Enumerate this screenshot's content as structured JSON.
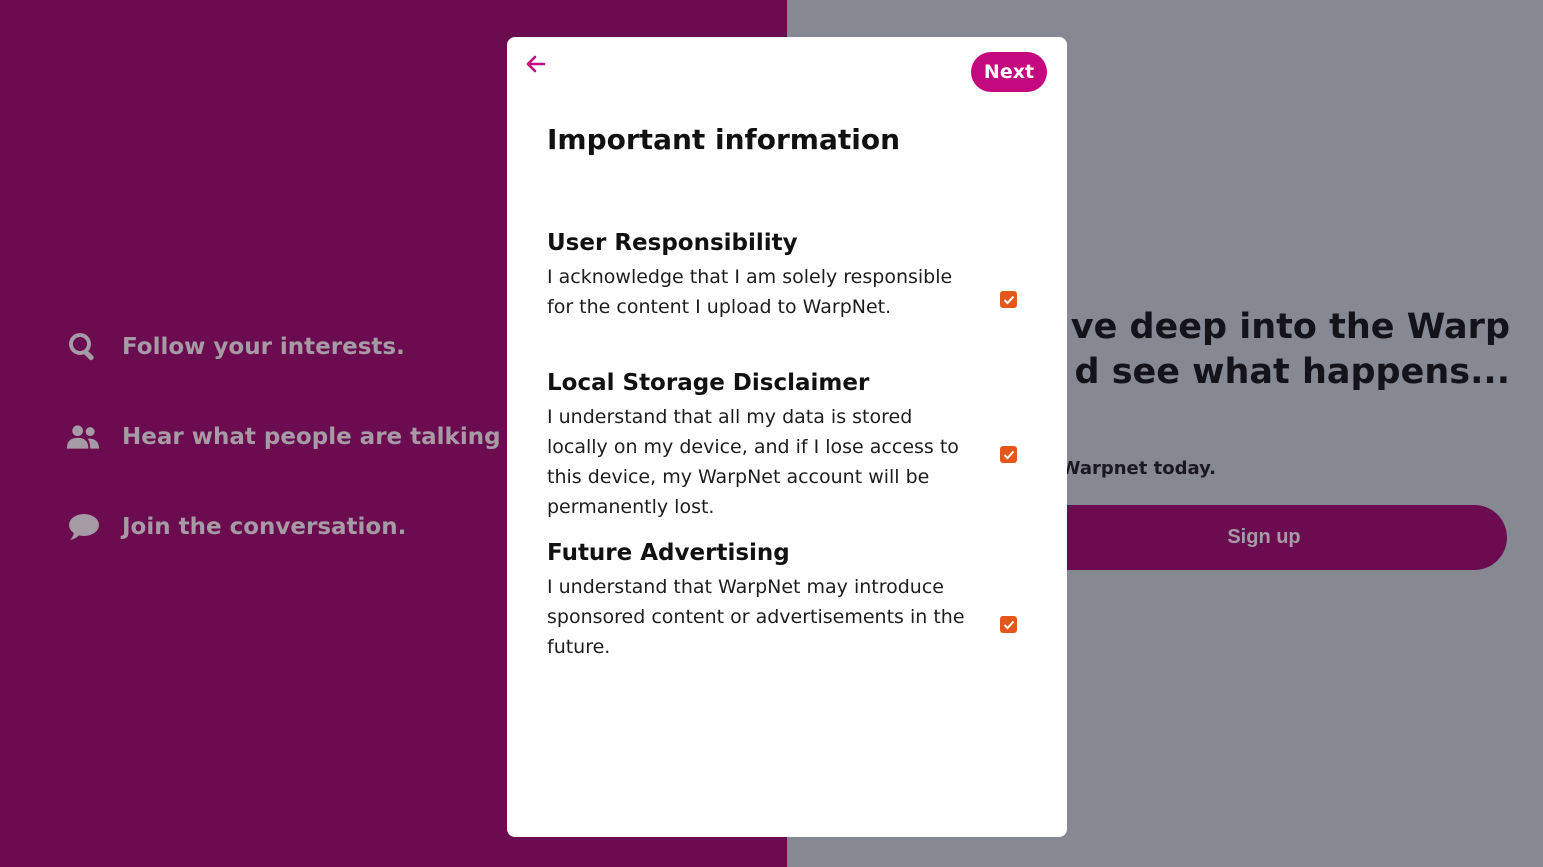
{
  "background": {
    "features": [
      {
        "icon": "search-icon",
        "text": "Follow your interests."
      },
      {
        "icon": "people-icon",
        "text": "Hear what people are talking abo"
      },
      {
        "icon": "chat-bubble-icon",
        "text": "Join the conversation."
      }
    ],
    "hero_line1": "ve deep into the Warp",
    "hero_line2": "d see what happens...",
    "join_text": "Warpnet today.",
    "signup_label": "Sign up"
  },
  "modal": {
    "next_label": "Next",
    "title": "Important information",
    "sections": [
      {
        "title": "User Responsibility",
        "text": "I acknowledge that I am solely responsible for the content I upload to WarpNet.",
        "checked": true
      },
      {
        "title": "Local Storage Disclaimer",
        "text": "I understand that all my data is stored locally on my device, and if I lose access to this device, my WarpNet account will be permanently lost.",
        "checked": true
      },
      {
        "title": "Future Advertising",
        "text": "I understand that WarpNet may introduce sponsored content or advertisements in the future.",
        "checked": true
      }
    ]
  },
  "colors": {
    "left_bg": "#6b0c50",
    "right_bg": "#868991",
    "accent": "#c4087e",
    "checkbox": "#e4571c"
  }
}
